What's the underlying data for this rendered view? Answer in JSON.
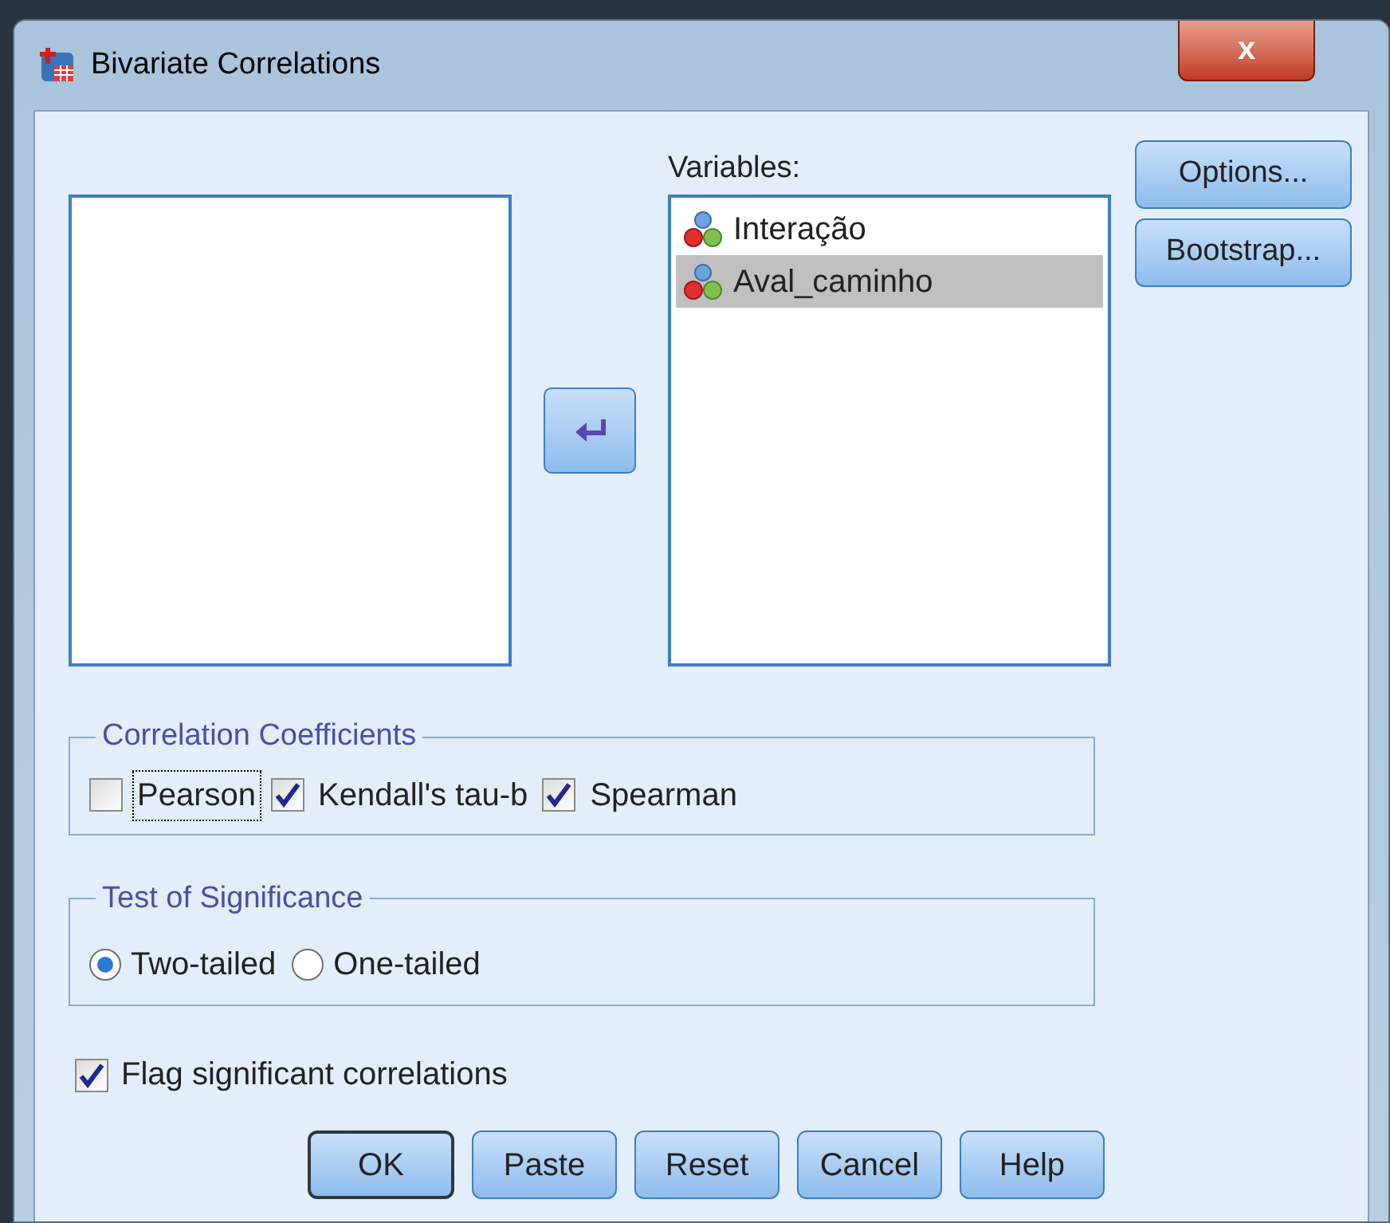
{
  "window": {
    "title": "Bivariate Correlations",
    "close_label": "x"
  },
  "variables": {
    "label": "Variables:",
    "items": [
      {
        "name": "Interação",
        "selected": false
      },
      {
        "name": "Aval_caminho",
        "selected": true
      }
    ]
  },
  "side_buttons": [
    "Options...",
    "Bootstrap..."
  ],
  "correlation_coefficients": {
    "title": "Correlation Coefficients",
    "options": [
      {
        "label": "Pearson",
        "checked": false,
        "focused": true
      },
      {
        "label": "Kendall's tau-b",
        "checked": true,
        "focused": false
      },
      {
        "label": "Spearman",
        "checked": true,
        "focused": false
      }
    ]
  },
  "test_of_significance": {
    "title": "Test of Significance",
    "options": [
      {
        "label": "Two-tailed",
        "selected": true
      },
      {
        "label": "One-tailed",
        "selected": false
      }
    ]
  },
  "flag_significant": {
    "label": "Flag significant correlations",
    "checked": true
  },
  "buttons": [
    {
      "label": "OK",
      "default": true
    },
    {
      "label": "Paste",
      "default": false
    },
    {
      "label": "Reset",
      "default": false
    },
    {
      "label": "Cancel",
      "default": false
    },
    {
      "label": "Help",
      "default": false
    }
  ]
}
